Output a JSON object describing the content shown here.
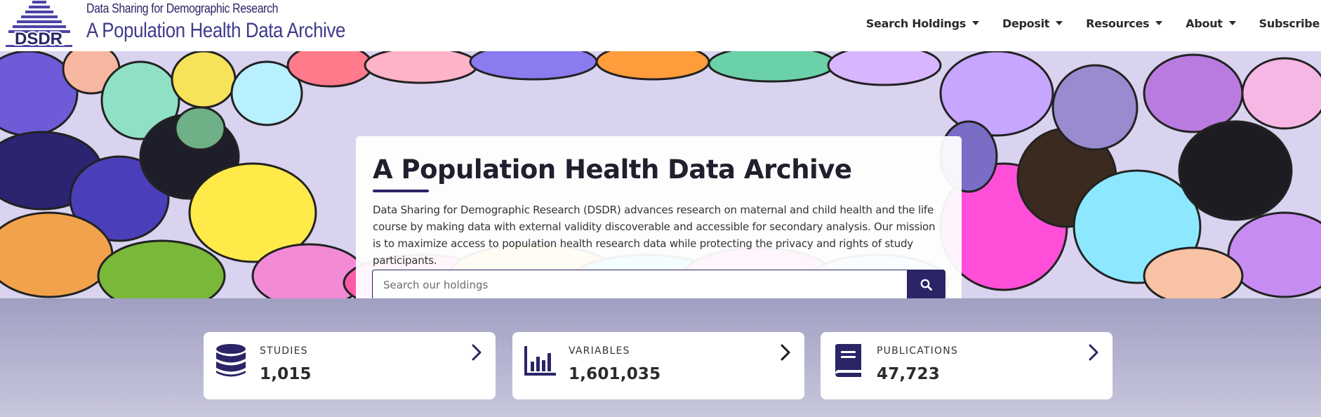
{
  "header": {
    "logo_abbr": "DSDR",
    "logo_subtitle": "Data Sharing for Demographic Research",
    "logo_title": "A Population Health Data Archive",
    "brand_color": "#2a2566",
    "nav": [
      {
        "label": "Search Holdings",
        "dropdown": true
      },
      {
        "label": "Deposit",
        "dropdown": true
      },
      {
        "label": "Resources",
        "dropdown": true
      },
      {
        "label": "About",
        "dropdown": true
      },
      {
        "label": "Subscribe",
        "dropdown": false
      }
    ]
  },
  "hero": {
    "title": "A Population Health Data Archive",
    "description": "Data Sharing for Demographic Research (DSDR) advances research on maternal and child health and the life course by making data with external validity discoverable and accessible for secondary analysis. Our mission is to maximize access to population health research data while protecting the privacy and rights of study participants.",
    "search": {
      "placeholder": "Search our holdings",
      "value": "",
      "icon": "search-icon"
    }
  },
  "stats": [
    {
      "label": "STUDIES",
      "value": "1,015",
      "icon": "database-icon"
    },
    {
      "label": "VARIABLES",
      "value": "1,601,035",
      "icon": "bar-chart-icon"
    },
    {
      "label": "PUBLICATIONS",
      "value": "47,723",
      "icon": "book-icon"
    }
  ]
}
